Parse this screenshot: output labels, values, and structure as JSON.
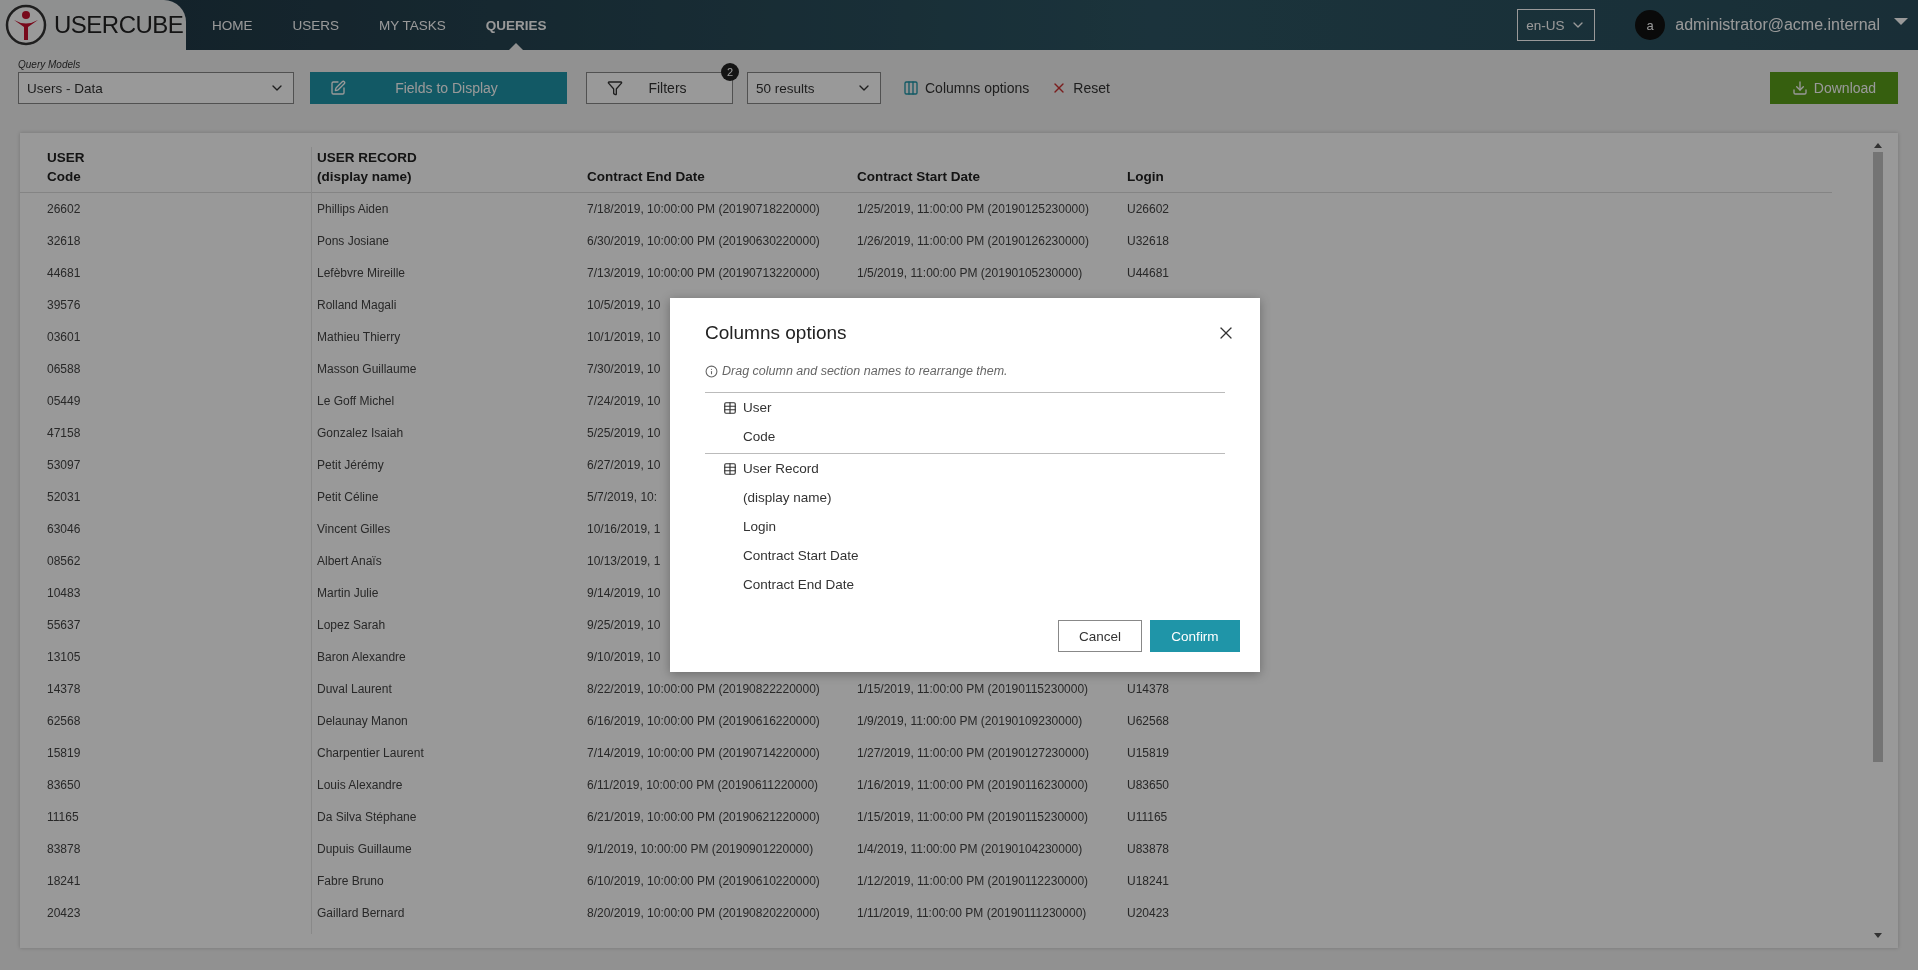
{
  "app": {
    "logo": "USERCUBE"
  },
  "nav": [
    {
      "label": "HOME",
      "selected": false
    },
    {
      "label": "USERS",
      "selected": false
    },
    {
      "label": "MY TASKS",
      "selected": false
    },
    {
      "label": "QUERIES",
      "selected": true
    }
  ],
  "language": "en-US",
  "user": {
    "avatar": "a",
    "email": "administrator@acme.internal"
  },
  "toolbar": {
    "query_models": {
      "label": "Query Models",
      "value": "Users - Data"
    },
    "fields_button": "Fields to Display",
    "filters": {
      "label": "Filters",
      "badge": "2"
    },
    "results": "50 results",
    "columns_options": "Columns options",
    "reset": "Reset",
    "download": "Download"
  },
  "table": {
    "columns": [
      {
        "section": "USER",
        "label": "Code"
      },
      {
        "section": "USER RECORD",
        "label": "(display name)"
      },
      {
        "label": "Contract End Date"
      },
      {
        "label": "Contract Start Date"
      },
      {
        "label": "Login"
      }
    ],
    "rows": [
      {
        "code": "26602",
        "name": "Phillips Aiden",
        "end": "7/18/2019, 10:00:00 PM (20190718220000)",
        "start": "1/25/2019, 11:00:00 PM (20190125230000)",
        "login": "U26602"
      },
      {
        "code": "32618",
        "name": "Pons Josiane",
        "end": "6/30/2019, 10:00:00 PM (20190630220000)",
        "start": "1/26/2019, 11:00:00 PM (20190126230000)",
        "login": "U32618"
      },
      {
        "code": "44681",
        "name": "Lefèbvre Mireille",
        "end": "7/13/2019, 10:00:00 PM (20190713220000)",
        "start": "1/5/2019, 11:00:00 PM (20190105230000)",
        "login": "U44681"
      },
      {
        "code": "39576",
        "name": "Rolland Magali",
        "end": "10/5/2019, 10"
      },
      {
        "code": "03601",
        "name": "Mathieu Thierry",
        "end": "10/1/2019, 10"
      },
      {
        "code": "06588",
        "name": "Masson Guillaume",
        "end": "7/30/2019, 10"
      },
      {
        "code": "05449",
        "name": "Le Goff Michel",
        "end": "7/24/2019, 10"
      },
      {
        "code": "47158",
        "name": "Gonzalez Isaiah",
        "end": "5/25/2019, 10"
      },
      {
        "code": "53097",
        "name": "Petit Jérémy",
        "end": "6/27/2019, 10"
      },
      {
        "code": "52031",
        "name": "Petit Céline",
        "end": "5/7/2019, 10:"
      },
      {
        "code": "63046",
        "name": "Vincent Gilles",
        "end": "10/16/2019, 1"
      },
      {
        "code": "08562",
        "name": "Albert Anaïs",
        "end": "10/13/2019, 1"
      },
      {
        "code": "10483",
        "name": "Martin Julie",
        "end": "9/14/2019, 10"
      },
      {
        "code": "55637",
        "name": "Lopez Sarah",
        "end": "9/25/2019, 10"
      },
      {
        "code": "13105",
        "name": "Baron Alexandre",
        "end": "9/10/2019, 10"
      },
      {
        "code": "14378",
        "name": "Duval Laurent",
        "end": "8/22/2019, 10:00:00 PM (20190822220000)",
        "start": "1/15/2019, 11:00:00 PM (20190115230000)",
        "login": "U14378"
      },
      {
        "code": "62568",
        "name": "Delaunay Manon",
        "end": "6/16/2019, 10:00:00 PM (20190616220000)",
        "start": "1/9/2019, 11:00:00 PM (20190109230000)",
        "login": "U62568"
      },
      {
        "code": "15819",
        "name": "Charpentier Laurent",
        "end": "7/14/2019, 10:00:00 PM (20190714220000)",
        "start": "1/27/2019, 11:00:00 PM (20190127230000)",
        "login": "U15819"
      },
      {
        "code": "83650",
        "name": "Louis Alexandre",
        "end": "6/11/2019, 10:00:00 PM (20190611220000)",
        "start": "1/16/2019, 11:00:00 PM (20190116230000)",
        "login": "U83650"
      },
      {
        "code": "11165",
        "name": "Da Silva Stéphane",
        "end": "6/21/2019, 10:00:00 PM (20190621220000)",
        "start": "1/15/2019, 11:00:00 PM (20190115230000)",
        "login": "U11165"
      },
      {
        "code": "83878",
        "name": "Dupuis Guillaume",
        "end": "9/1/2019, 10:00:00 PM (20190901220000)",
        "start": "1/4/2019, 11:00:00 PM (20190104230000)",
        "login": "U83878"
      },
      {
        "code": "18241",
        "name": "Fabre Bruno",
        "end": "6/10/2019, 10:00:00 PM (20190610220000)",
        "start": "1/12/2019, 11:00:00 PM (20190112230000)",
        "login": "U18241"
      },
      {
        "code": "20423",
        "name": "Gaillard Bernard",
        "end": "8/20/2019, 10:00:00 PM (20190820220000)",
        "start": "1/11/2019, 11:00:00 PM (20190111230000)",
        "login": "U20423"
      }
    ]
  },
  "dialog": {
    "title": "Columns options",
    "hint": "Drag column and section names to rearrange them.",
    "sections": [
      {
        "name": "User",
        "columns": [
          "Code"
        ]
      },
      {
        "name": "User Record",
        "columns": [
          "(display name)",
          "Login",
          "Contract Start Date",
          "Contract End Date"
        ]
      }
    ],
    "cancel": "Cancel",
    "confirm": "Confirm"
  }
}
